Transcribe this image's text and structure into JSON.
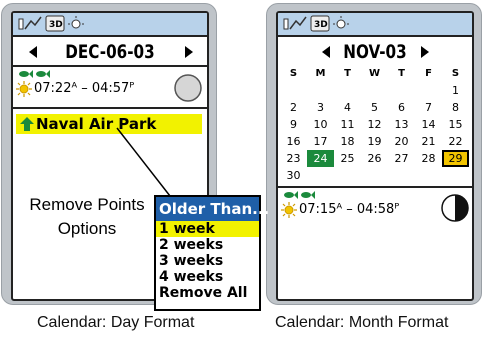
{
  "day_view": {
    "date_label": "DEC-06-03",
    "sun_times": "07:22ᴬ – 04:57ᴾ",
    "waypoint_name": "Naval Air Park",
    "moon_phase": "full"
  },
  "month_view": {
    "month_label": "NOV-03",
    "weekday_headers": [
      "S",
      "M",
      "T",
      "W",
      "T",
      "F",
      "S"
    ],
    "weeks": [
      [
        "",
        "",
        "",
        "",
        "",
        "",
        "1"
      ],
      [
        "2",
        "3",
        "4",
        "5",
        "6",
        "7",
        "8"
      ],
      [
        "9",
        "10",
        "11",
        "12",
        "13",
        "14",
        "15"
      ],
      [
        "16",
        "17",
        "18",
        "19",
        "20",
        "21",
        "22"
      ],
      [
        "23",
        "24",
        "25",
        "26",
        "27",
        "28",
        "29"
      ],
      [
        "30",
        "",
        "",
        "",
        "",
        "",
        ""
      ]
    ],
    "today_day": "24",
    "selected_day": "29",
    "sun_times": "07:15ᴬ – 04:58ᴾ",
    "moon_phase": "first-quarter"
  },
  "popup": {
    "title": "Older Than...",
    "options": [
      "1 week",
      "2 weeks",
      "3 weeks",
      "4 weeks",
      "Remove All"
    ],
    "selected_index": 0
  },
  "annotation": {
    "line1": "Remove Points",
    "line2": "Options"
  },
  "captions": {
    "left": "Calendar: Day Format",
    "right": "Calendar: Month Format"
  },
  "colors": {
    "status_bar": "#b8d2ea",
    "highlight": "#f2f200",
    "popup_title": "#1f5fa8",
    "today": "#1b8a3c",
    "selected": "#f2c400"
  }
}
